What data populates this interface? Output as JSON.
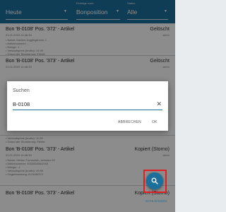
{
  "filters": {
    "date": {
      "label": "",
      "value": "Heute"
    },
    "type": {
      "label": "Einträge nach",
      "value": "Bonposition"
    },
    "status": {
      "label": "Status",
      "value": "Alle"
    }
  },
  "entries": [
    {
      "title": "Bon 'B-0108' Pos. '372' - Artikel",
      "status": "Gelöscht",
      "datetime": "21.01.2019 14:46:33",
      "user": "admin",
      "details": [
        "• Name: Damen Joggingshose, L",
        "• Artikelnummer: ...",
        "• Menge: 1",
        "• Verkaufspreis (brutto): 14,99",
        "• Grund der Stornierung: Fehler"
      ]
    },
    {
      "title": "Bon 'B-0108' Pos. '373' - Artikel",
      "status": "Gelöscht",
      "datetime": "21.01.2019 14:46:33",
      "user": "admin",
      "details": []
    },
    {
      "title": "Bon 'B-0108' Pos. '373' - Artikel",
      "status": "Kopiert (Storno)",
      "datetime": "21.01.2019 14:46:33",
      "user": "admin",
      "details": [
        "• Verkaufspreis (brutto): 11,99",
        "• Grund der Stornierung: Fehler",
        "• Name: Herren Turnschuh, schwarz 42",
        "• Artikelnummer: 4002816064/004",
        "• Menge: -1",
        "• Verkaufspreis (brutto): 49,99",
        "• Gegenbuchung: B-0108/373"
      ]
    },
    {
      "title": "Bon 'B-0108' Pos. '373' - Artikel",
      "status": "Kopiert (Storno)",
      "datetime": "",
      "user": "",
      "details": []
    }
  ],
  "dialog": {
    "title": "Suchen",
    "input_value": "B-0108",
    "cancel_label": "ABBRECHEN",
    "ok_label": "OK"
  },
  "fab": {
    "icon": "search-icon",
    "color": "#1d6f9b",
    "highlight_color": "#e01e24"
  },
  "close_label": "SCHLIESSEN",
  "colors": {
    "primary": "#1d6f9b"
  }
}
